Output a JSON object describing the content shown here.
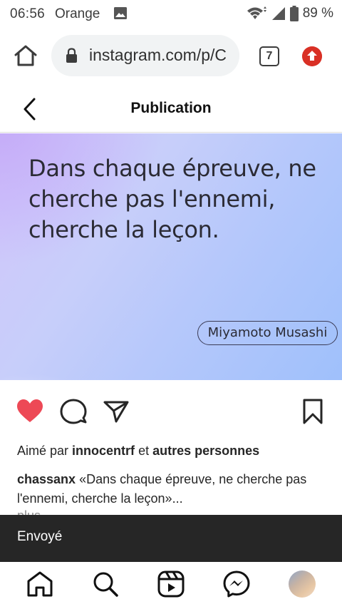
{
  "status_bar": {
    "time": "06:56",
    "carrier": "Orange",
    "battery": "89 %",
    "icons": [
      "image-icon",
      "wifi-icon",
      "signal-icon",
      "battery-icon"
    ]
  },
  "browser": {
    "url": "instagram.com/p/C",
    "tab_count": "7",
    "icons": [
      "home-icon",
      "lock-icon",
      "update-icon"
    ]
  },
  "header": {
    "title": "Publication"
  },
  "post": {
    "quote_text": "Dans chaque épreuve, ne cherche pas l'ennemi, cherche la leçon.",
    "author": "Miyamoto Musashi",
    "gradient_colors": [
      "#c4aaf8",
      "#b6c8fb",
      "#9fc0fb",
      "#ffffff"
    ]
  },
  "actions": {
    "liked": true,
    "like_color": "#ed4956",
    "icons": [
      "heart-icon",
      "comment-icon",
      "share-icon",
      "bookmark-icon"
    ]
  },
  "likes": {
    "prefix": "Aimé par",
    "user": "innocentrf",
    "connector": "et",
    "others": "autres personnes"
  },
  "caption": {
    "username": "chassanx",
    "text": "«Dans chaque épreuve, ne cherche pas l'ennemi, cherche la leçon»...",
    "more": "plus"
  },
  "snackbar": {
    "text": "Envoyé"
  },
  "bottom_nav": {
    "items": [
      "home-icon",
      "search-icon",
      "reels-icon",
      "messenger-icon",
      "avatar"
    ]
  },
  "colors": {
    "snackbar_bg": "#262626",
    "update_badge": "#d93025",
    "text": "#262626"
  }
}
